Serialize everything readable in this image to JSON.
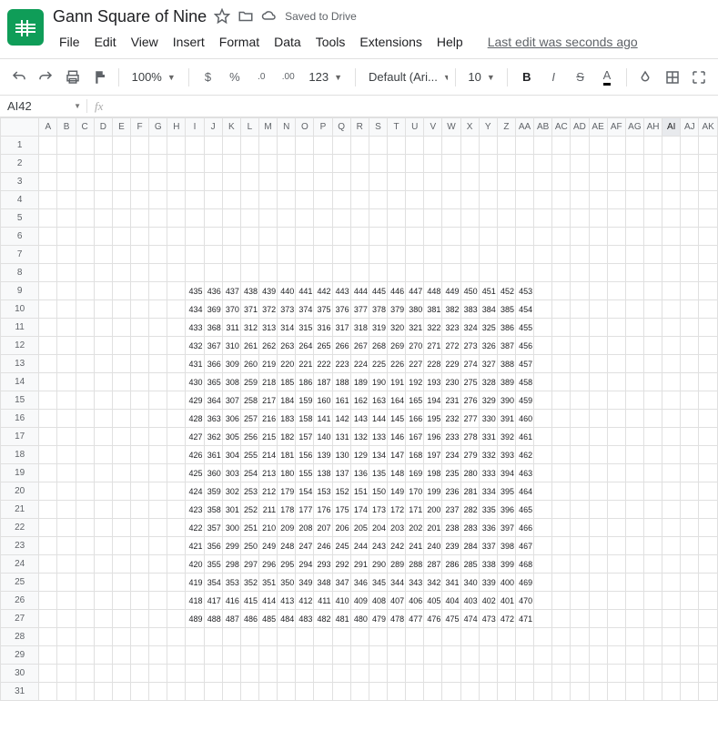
{
  "doc": {
    "title": "Gann Square of Nine",
    "saved": "Saved to Drive",
    "last_edit": "Last edit was seconds ago"
  },
  "menu": {
    "file": "File",
    "edit": "Edit",
    "view": "View",
    "insert": "Insert",
    "format": "Format",
    "data": "Data",
    "tools": "Tools",
    "extensions": "Extensions",
    "help": "Help"
  },
  "toolbar": {
    "zoom": "100%",
    "currency": "$",
    "percent": "%",
    "dec_dec": ".0",
    "inc_dec": ".00",
    "more_formats": "123",
    "font": "Default (Ari...",
    "font_size": "10",
    "bold": "B",
    "italic": "I",
    "strike": "S",
    "textcolor": "A"
  },
  "formula": {
    "name_box": "AI42",
    "fx": "fx",
    "value": ""
  },
  "grid": {
    "columns": [
      "A",
      "B",
      "C",
      "D",
      "E",
      "F",
      "G",
      "H",
      "I",
      "J",
      "K",
      "L",
      "M",
      "N",
      "O",
      "P",
      "Q",
      "R",
      "S",
      "T",
      "U",
      "V",
      "W",
      "X",
      "Y",
      "Z",
      "AA",
      "AB",
      "AC",
      "AD",
      "AE",
      "AF",
      "AG",
      "AH",
      "AI",
      "AJ",
      "AK"
    ],
    "active_col": "AI",
    "row_count": 31,
    "data_start_col": 9,
    "data_start_row": 9,
    "selected": {
      "row": 42,
      "col": 35
    }
  },
  "chart_data": {
    "type": "table",
    "title": "Gann Square of Nine",
    "rows": [
      [
        435,
        436,
        437,
        438,
        439,
        440,
        441,
        442,
        443,
        444,
        445,
        446,
        447,
        448,
        449,
        450,
        451,
        452,
        453
      ],
      [
        434,
        369,
        370,
        371,
        372,
        373,
        374,
        375,
        376,
        377,
        378,
        379,
        380,
        381,
        382,
        383,
        384,
        385,
        454
      ],
      [
        433,
        368,
        311,
        312,
        313,
        314,
        315,
        316,
        317,
        318,
        319,
        320,
        321,
        322,
        323,
        324,
        325,
        386,
        455
      ],
      [
        432,
        367,
        310,
        261,
        262,
        263,
        264,
        265,
        266,
        267,
        268,
        269,
        270,
        271,
        272,
        273,
        326,
        387,
        456
      ],
      [
        431,
        366,
        309,
        260,
        219,
        220,
        221,
        222,
        223,
        224,
        225,
        226,
        227,
        228,
        229,
        274,
        327,
        388,
        457
      ],
      [
        430,
        365,
        308,
        259,
        218,
        185,
        186,
        187,
        188,
        189,
        190,
        191,
        192,
        193,
        230,
        275,
        328,
        389,
        458
      ],
      [
        429,
        364,
        307,
        258,
        217,
        184,
        159,
        160,
        161,
        162,
        163,
        164,
        165,
        194,
        231,
        276,
        329,
        390,
        459
      ],
      [
        428,
        363,
        306,
        257,
        216,
        183,
        158,
        141,
        142,
        143,
        144,
        145,
        166,
        195,
        232,
        277,
        330,
        391,
        460
      ],
      [
        427,
        362,
        305,
        256,
        215,
        182,
        157,
        140,
        131,
        132,
        133,
        146,
        167,
        196,
        233,
        278,
        331,
        392,
        461
      ],
      [
        426,
        361,
        304,
        255,
        214,
        181,
        156,
        139,
        130,
        129,
        134,
        147,
        168,
        197,
        234,
        279,
        332,
        393,
        462
      ],
      [
        425,
        360,
        303,
        254,
        213,
        180,
        155,
        138,
        137,
        136,
        135,
        148,
        169,
        198,
        235,
        280,
        333,
        394,
        463
      ],
      [
        424,
        359,
        302,
        253,
        212,
        179,
        154,
        153,
        152,
        151,
        150,
        149,
        170,
        199,
        236,
        281,
        334,
        395,
        464
      ],
      [
        423,
        358,
        301,
        252,
        211,
        178,
        177,
        176,
        175,
        174,
        173,
        172,
        171,
        200,
        237,
        282,
        335,
        396,
        465
      ],
      [
        422,
        357,
        300,
        251,
        210,
        209,
        208,
        207,
        206,
        205,
        204,
        203,
        202,
        201,
        238,
        283,
        336,
        397,
        466
      ],
      [
        421,
        356,
        299,
        250,
        249,
        248,
        247,
        246,
        245,
        244,
        243,
        242,
        241,
        240,
        239,
        284,
        337,
        398,
        467
      ],
      [
        420,
        355,
        298,
        297,
        296,
        295,
        294,
        293,
        292,
        291,
        290,
        289,
        288,
        287,
        286,
        285,
        338,
        399,
        468
      ],
      [
        419,
        354,
        353,
        352,
        351,
        350,
        349,
        348,
        347,
        346,
        345,
        344,
        343,
        342,
        341,
        340,
        339,
        400,
        469
      ],
      [
        418,
        417,
        416,
        415,
        414,
        413,
        412,
        411,
        410,
        409,
        408,
        407,
        406,
        405,
        404,
        403,
        402,
        401,
        470
      ],
      [
        489,
        488,
        487,
        486,
        485,
        484,
        483,
        482,
        481,
        480,
        479,
        478,
        477,
        476,
        475,
        474,
        473,
        472,
        471
      ]
    ]
  }
}
